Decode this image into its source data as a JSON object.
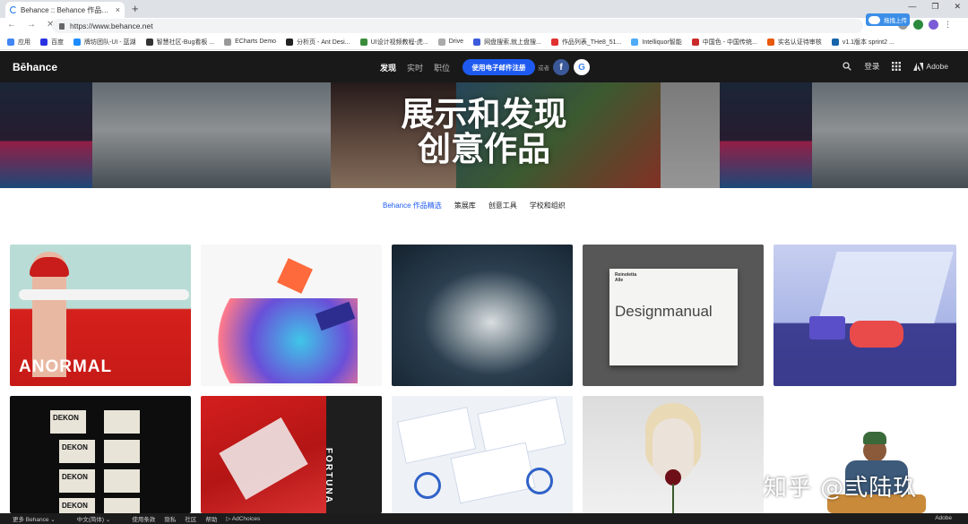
{
  "browser": {
    "tab_title": "Behance :: Behance 作品精选",
    "tab_close": "×",
    "new_tab": "+",
    "url": "https://www.behance.net",
    "upload_badge": "拖拽上传",
    "window_controls": [
      "—",
      "❐",
      "✕"
    ]
  },
  "bookmarks": [
    {
      "label": "应用",
      "color": "#4285f4"
    },
    {
      "label": "百度",
      "color": "#2932e1"
    },
    {
      "label": "牌坊团队-UI - 蓝湖",
      "color": "#1a8cff"
    },
    {
      "label": "智慧社区-Bug看板 ...",
      "color": "#333333"
    },
    {
      "label": "ECharts Demo",
      "color": "#999999"
    },
    {
      "label": "分析页 - Ant Desi...",
      "color": "#222222"
    },
    {
      "label": "UI设计视频教程-虎...",
      "color": "#3a8c3a"
    },
    {
      "label": "Drive",
      "color": "#aaaaaa"
    },
    {
      "label": "网盘搜索,就上盘搜...",
      "color": "#3b5bdb"
    },
    {
      "label": "作品列表_THe8_51...",
      "color": "#e03131"
    },
    {
      "label": "Intelliquor智能",
      "color": "#4dabf7"
    },
    {
      "label": "中国色 - 中国传统...",
      "color": "#c92a2a"
    },
    {
      "label": "实名认证待审核",
      "color": "#e8590c"
    },
    {
      "label": "v1.1版本 sprint2 ...",
      "color": "#1864ab"
    }
  ],
  "behance_nav": {
    "logo": "Bēhance",
    "links": [
      "发现",
      "实时",
      "职位"
    ],
    "signup_button": "使用电子邮件注册",
    "or_text": "或者",
    "facebook": "f",
    "google": "G",
    "login": "登录",
    "adobe": "Adobe"
  },
  "hero": {
    "title_line1": "展示和发现",
    "title_line2": "创意作品"
  },
  "subnav": [
    "Behance 作品精选",
    "策展库",
    "创意工具",
    "学校和组织"
  ],
  "cards": {
    "anormal": "ANORMAL",
    "designmanual": "Designmanual",
    "reinoletta": "Reinoletta",
    "alle": "Alle",
    "dekon": "DEKON",
    "fortuna": "FORTUNA"
  },
  "footer": {
    "items": [
      "更多 Behance ⌄",
      "中文(简体) ⌄",
      "使用条款",
      "隐私",
      "社区",
      "帮助",
      "▷ AdChoices"
    ],
    "adobe": "Adobe"
  },
  "watermark": "知乎 @弎陆玖"
}
